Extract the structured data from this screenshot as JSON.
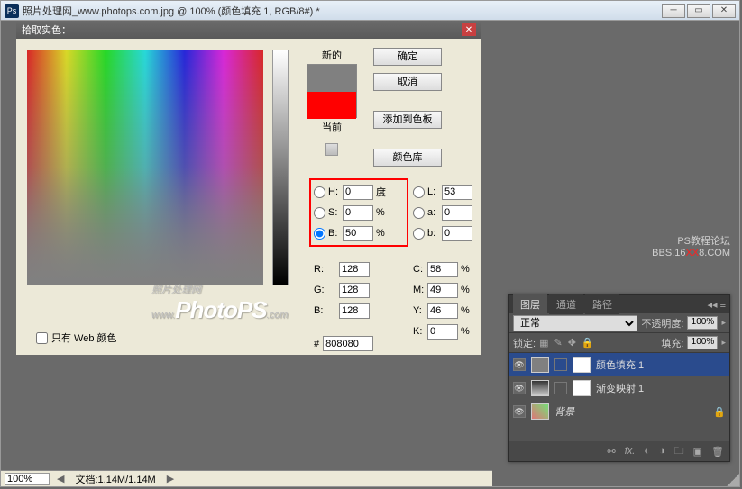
{
  "window": {
    "title": "照片处理网_www.photops.com.jpg @ 100% (颜色填充 1, RGB/8#) *",
    "icon_label": "Ps"
  },
  "dialog": {
    "title": "拾取实色：",
    "new_label": "新的",
    "current_label": "当前",
    "buttons": {
      "ok": "确定",
      "cancel": "取消",
      "add": "添加到色板",
      "library": "颜色库"
    },
    "hsb": {
      "h_label": "H:",
      "h": "0",
      "h_unit": "度",
      "s_label": "S:",
      "s": "0",
      "s_unit": "%",
      "b_label": "B:",
      "b": "50",
      "b_unit": "%"
    },
    "lab": {
      "l_label": "L:",
      "l": "53",
      "a_label": "a:",
      "a": "0",
      "b_label": "b:",
      "b": "0"
    },
    "rgb": {
      "r_label": "R:",
      "r": "128",
      "g_label": "G:",
      "g": "128",
      "b_label": "B:",
      "b": "128"
    },
    "cmyk": {
      "c_label": "C:",
      "c": "58",
      "c_unit": "%",
      "m_label": "M:",
      "m": "49",
      "m_unit": "%",
      "y_label": "Y:",
      "y": "46",
      "y_unit": "%",
      "k_label": "K:",
      "k": "0",
      "k_unit": "%"
    },
    "hex": {
      "label": "#",
      "value": "808080"
    },
    "webonly": "只有 Web 颜色"
  },
  "watermark": {
    "small": "照片处理网",
    "url": "www.",
    "brand": "PhotoPS",
    "tld": ".com"
  },
  "forum": {
    "line1": "PS教程论坛",
    "line2a": "BBS.16",
    "line2b": "XX",
    "line2c": "8.COM"
  },
  "layers": {
    "tabs": {
      "t1": "图层",
      "t2": "通道",
      "t3": "路径"
    },
    "blend": "正常",
    "opacity_label": "不透明度:",
    "opacity": "100%",
    "lock_label": "锁定:",
    "fill_label": "填充:",
    "fill": "100%",
    "items": [
      {
        "name": "颜色填充 1"
      },
      {
        "name": "渐变映射 1"
      },
      {
        "name": "背景"
      }
    ]
  },
  "status": {
    "zoom": "100%",
    "doc": "文档:1.14M/1.14M"
  }
}
